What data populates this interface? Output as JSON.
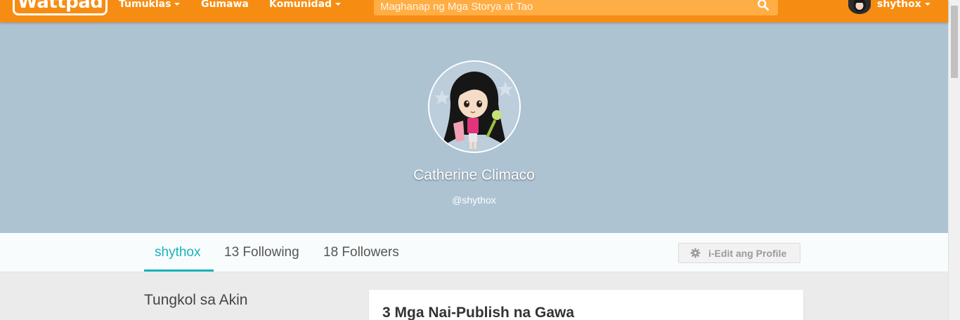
{
  "topbar": {
    "logo": "Wattpad",
    "nav": [
      {
        "label": "Tumuklas",
        "has_caret": true
      },
      {
        "label": "Gumawa",
        "has_caret": false
      },
      {
        "label": "Komunidad",
        "has_caret": true
      }
    ],
    "search": {
      "placeholder": "Maghanap ng Mga Storya at Tao",
      "icon": "search-icon"
    },
    "user": {
      "username": "shythox",
      "has_caret": true
    },
    "color": "#f68d12"
  },
  "profile": {
    "full_name": "Catherine Climaco",
    "handle": "@shythox",
    "header_color": "#adc3d2"
  },
  "tabs": {
    "items": [
      {
        "label": "shythox",
        "active": true
      },
      {
        "label": "13 Following",
        "active": false
      },
      {
        "label": "18 Followers",
        "active": false
      }
    ],
    "edit_button": {
      "label": "i-Edit ang Profile",
      "icon": "gear-icon"
    },
    "accent": "#17b3bd"
  },
  "content": {
    "about_title": "Tungkol sa Akin",
    "works_title": "3 Mga Nai-Publish na Gawa"
  }
}
